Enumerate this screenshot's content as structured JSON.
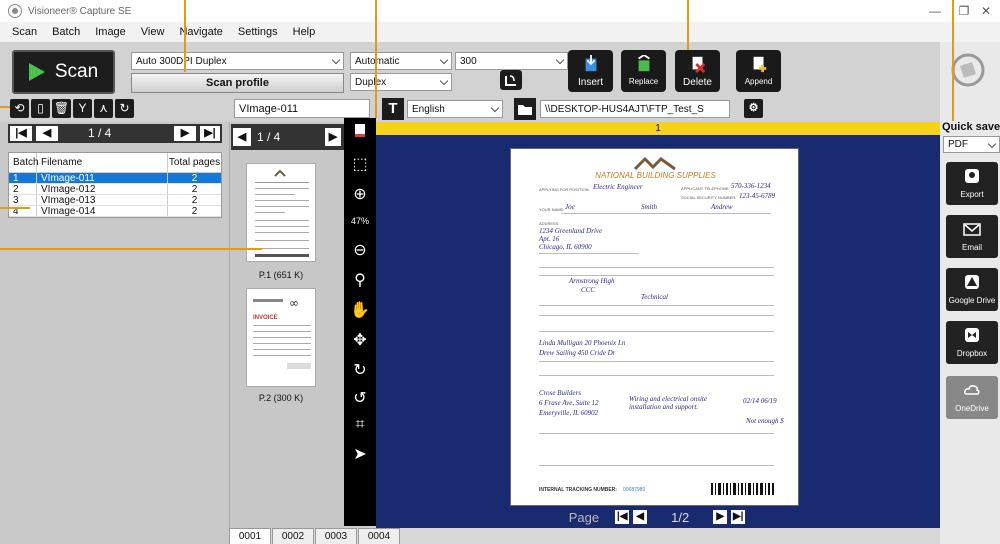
{
  "window": {
    "title": "Visioneer® Capture SE",
    "min": "—",
    "max": "❐",
    "close": "✕"
  },
  "menu": [
    "Scan",
    "Batch",
    "Image",
    "View",
    "Navigate",
    "Settings",
    "Help"
  ],
  "scan_panel": {
    "scan_label": "Scan",
    "profile_value": "Auto 300DPI Duplex",
    "profile_button": "Scan profile",
    "color_mode": "Automatic",
    "dpi": "300",
    "sides": "Duplex",
    "dropdown_3": ""
  },
  "doc_actions": {
    "insert": "Insert",
    "replace": "Replace",
    "delete": "Delete",
    "append": "Append"
  },
  "row2": {
    "filename_value": "VImage-011",
    "language": "English",
    "path": "\\\\DESKTOP-HUS4AJT\\FTP_Test_S"
  },
  "batch_nav": {
    "page": "1 / 4"
  },
  "batch_table": {
    "headers": [
      "Batch",
      "Filename",
      "Total pages"
    ],
    "rows": [
      [
        "1",
        "VImage-011",
        "2"
      ],
      [
        "2",
        "VImage-012",
        "2"
      ],
      [
        "3",
        "VImage-013",
        "2"
      ],
      [
        "4",
        "VImage-014",
        "2"
      ]
    ],
    "selected_index": 0
  },
  "thumb_nav": {
    "page": "1 / 4"
  },
  "thumbnails": [
    {
      "caption": "P.1 (651 K)"
    },
    {
      "caption": "P.2 (300 K)"
    }
  ],
  "thumb2_header": "INVOICE",
  "zoom_level": "47%",
  "viewer": {
    "page_indicator": "1",
    "pagebar_label": "Page",
    "pagebar_value": "1/2"
  },
  "document": {
    "company": "NATIONAL BUILDING SUPPLIES",
    "position_label": "APPLYING FOR POSITION:",
    "position_value": "Electric Engineer",
    "phone_label": "APPLICANT TELEPHONE:",
    "phone_value": "570-336-1234",
    "ssn_label": "SOCIAL SECURITY NUMBER:",
    "ssn_value": "123-45-6789",
    "name_label": "YOUR NAME:",
    "first_name": "Joe",
    "last_name": "Smith",
    "middle_name": "Andrew",
    "address_label": "ADDRESS:",
    "address_1": "1234 Greenland Drive",
    "address_2": "Apt. 16",
    "address_3": "Chicago, IL 60900",
    "edu_school": "Armstrong High",
    "edu_college": "CCC",
    "edu_course": "Technical",
    "ref_1": "Linda Mulligan  20 Phoenix Ln",
    "ref_2": "Drew Sailing  450 Cride Dr",
    "emp_name": "Crose Builders",
    "emp_addr": "6 Frase Ave, Suite 12",
    "emp_city": "Emeryville, IL 60902",
    "emp_duties": "Wiring and electrical onsite installation and support.",
    "emp_dates": "02/14 06/19",
    "emp_reason": "Not enough $",
    "tracking_label": "INTERNAL TRACKING NUMBER:",
    "tracking_value": "00687980"
  },
  "bottom_tabs": [
    "0001",
    "0002",
    "0003",
    "0004"
  ],
  "right_panel": {
    "quick_save": "Quick save",
    "format": "PDF",
    "buttons": [
      {
        "label": "Export"
      },
      {
        "label": "Email"
      },
      {
        "label": "Google Drive"
      },
      {
        "label": "Dropbox"
      },
      {
        "label": "OneDrive"
      }
    ]
  },
  "colors": {
    "accent_blue": "#1479d6",
    "viewer_bg": "#1a2a70",
    "page_bar_yellow": "#f7d21c",
    "callout_orange": "#e09a1e",
    "scan_green": "#4cc24c",
    "delete_red": "#d83030"
  }
}
